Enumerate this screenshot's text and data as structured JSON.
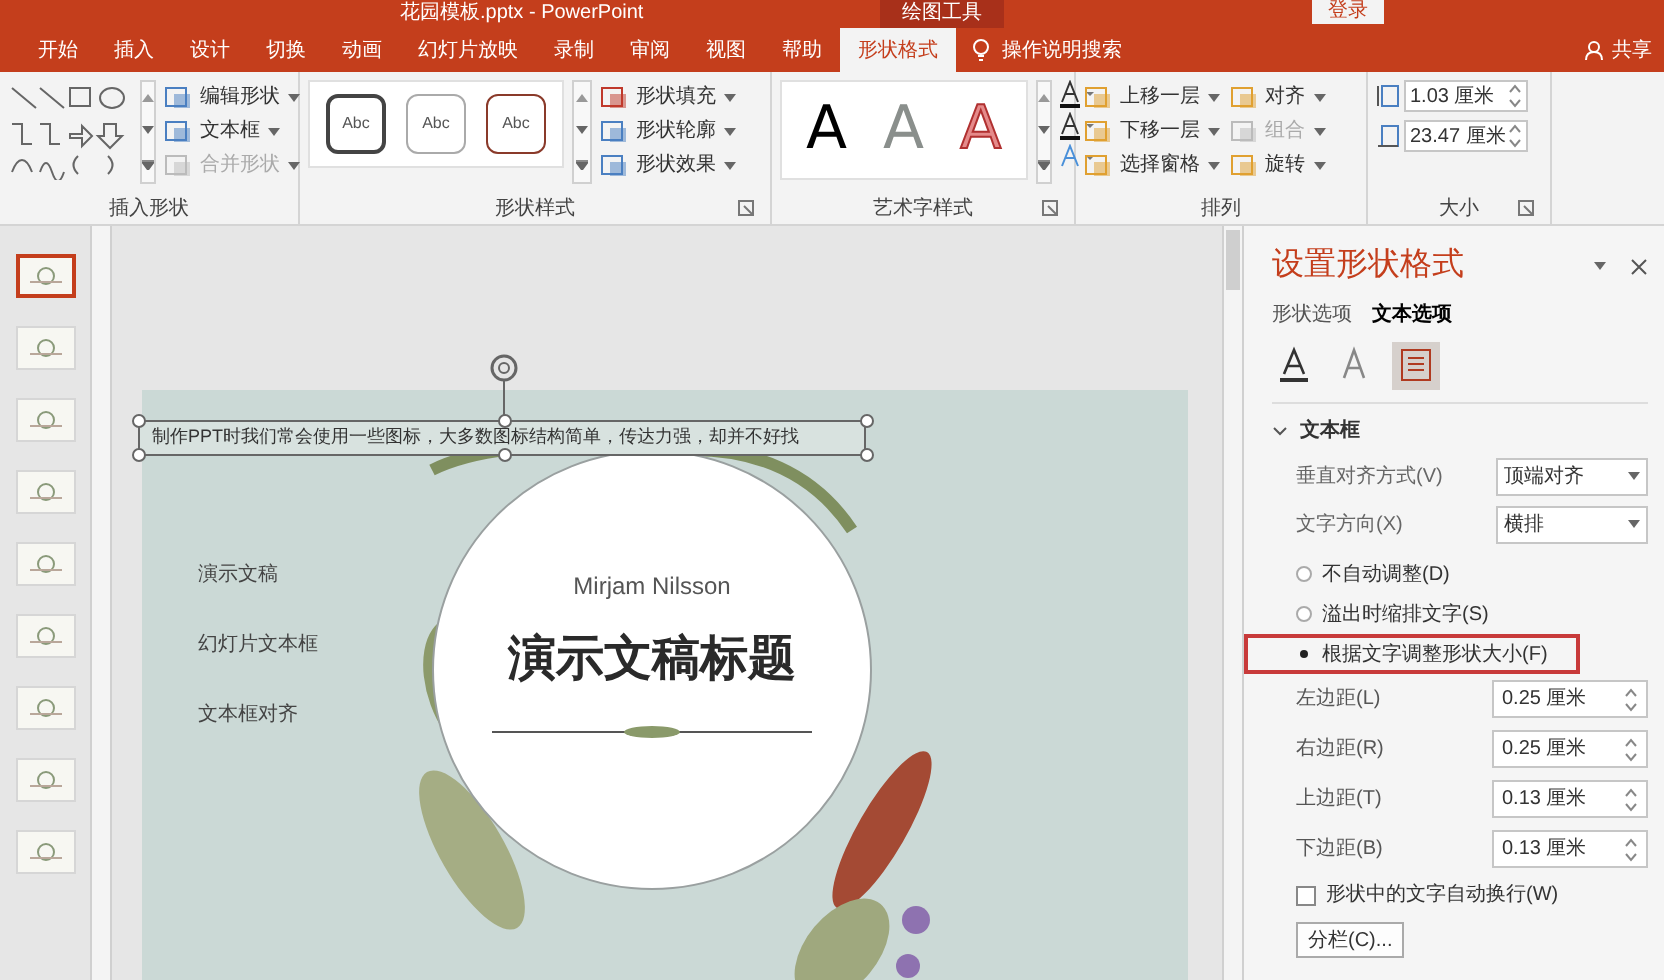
{
  "title_bar": {
    "title": "花园模板.pptx  -  PowerPoint",
    "context_tab": "绘图工具",
    "sign_in": "登录"
  },
  "tabs": [
    {
      "label": "开始",
      "selected": false
    },
    {
      "label": "插入",
      "selected": false
    },
    {
      "label": "设计",
      "selected": false
    },
    {
      "label": "切换",
      "selected": false
    },
    {
      "label": "动画",
      "selected": false
    },
    {
      "label": "幻灯片放映",
      "selected": false
    },
    {
      "label": "录制",
      "selected": false
    },
    {
      "label": "审阅",
      "selected": false
    },
    {
      "label": "视图",
      "selected": false
    },
    {
      "label": "帮助",
      "selected": false
    },
    {
      "label": "形状格式",
      "selected": true
    }
  ],
  "tell_me": "操作说明搜索",
  "share": "共享",
  "insert_shapes": {
    "label": "插入形状",
    "commands": [
      {
        "label": "编辑形状",
        "disabled": false
      },
      {
        "label": "文本框",
        "disabled": false
      },
      {
        "label": "合并形状",
        "disabled": true
      }
    ]
  },
  "shape_styles": {
    "label": "形状样式",
    "presets": [
      "Abc",
      "Abc",
      "Abc"
    ],
    "commands": [
      "形状填充",
      "形状轮廓",
      "形状效果"
    ]
  },
  "wordart_styles": {
    "label": "艺术字样式",
    "presets": [
      {
        "text": "A",
        "kind": "solid"
      },
      {
        "text": "A",
        "kind": "gray"
      },
      {
        "text": "A",
        "kind": "outline"
      }
    ]
  },
  "arrange": {
    "label": "排列",
    "commands": [
      {
        "label": "上移一层",
        "disabled": false
      },
      {
        "label": "下移一层",
        "disabled": false
      },
      {
        "label": "选择窗格",
        "disabled": false
      },
      {
        "label": "对齐",
        "disabled": false
      },
      {
        "label": "组合",
        "disabled": true
      },
      {
        "label": "旋转",
        "disabled": false
      }
    ]
  },
  "size": {
    "label": "大小",
    "height": "1.03 厘米",
    "width": "23.47 厘米"
  },
  "thumbnails": [
    {
      "selected": true
    },
    {
      "selected": false
    },
    {
      "selected": false
    },
    {
      "selected": false
    },
    {
      "selected": false
    },
    {
      "selected": false
    },
    {
      "selected": false
    },
    {
      "selected": false
    },
    {
      "selected": false
    }
  ],
  "slide": {
    "selected_text": "制作PPT时我们常会使用一些图标，大多数图标结构简单，传达力强，却并不好找",
    "items": [
      "演示文稿",
      "幻灯片文本框",
      "文本框对齐"
    ],
    "author": "Mirjam Nilsson",
    "title": "演示文稿标题"
  },
  "format_pane": {
    "title": "设置形状格式",
    "tabs": [
      {
        "label": "形状选项",
        "selected": false
      },
      {
        "label": "文本选项",
        "selected": true
      }
    ],
    "icon_tabs": [
      {
        "kind": "fill",
        "selected": false
      },
      {
        "kind": "effects",
        "selected": false
      },
      {
        "kind": "textbox",
        "selected": true
      }
    ],
    "section": {
      "label": "文本框",
      "expanded": true
    },
    "dropdowns": [
      {
        "label": "垂直对齐方式(V)",
        "value": "顶端对齐"
      },
      {
        "label": "文字方向(X)",
        "value": "横排"
      }
    ],
    "autofit": [
      {
        "label": "不自动调整(D)",
        "selected": false,
        "highlighted": false
      },
      {
        "label": "溢出时缩排文字(S)",
        "selected": false,
        "highlighted": false
      },
      {
        "label": "根据文字调整形状大小(F)",
        "selected": true,
        "highlighted": true
      }
    ],
    "margins": [
      {
        "label": "左边距(L)",
        "value": "0.25 厘米"
      },
      {
        "label": "右边距(R)",
        "value": "0.25 厘米"
      },
      {
        "label": "上边距(T)",
        "value": "0.13 厘米"
      },
      {
        "label": "下边距(B)",
        "value": "0.13 厘米"
      }
    ],
    "wrap": {
      "label": "形状中的文字自动换行(W)",
      "checked": false
    },
    "columns_button": "分栏(C)..."
  }
}
